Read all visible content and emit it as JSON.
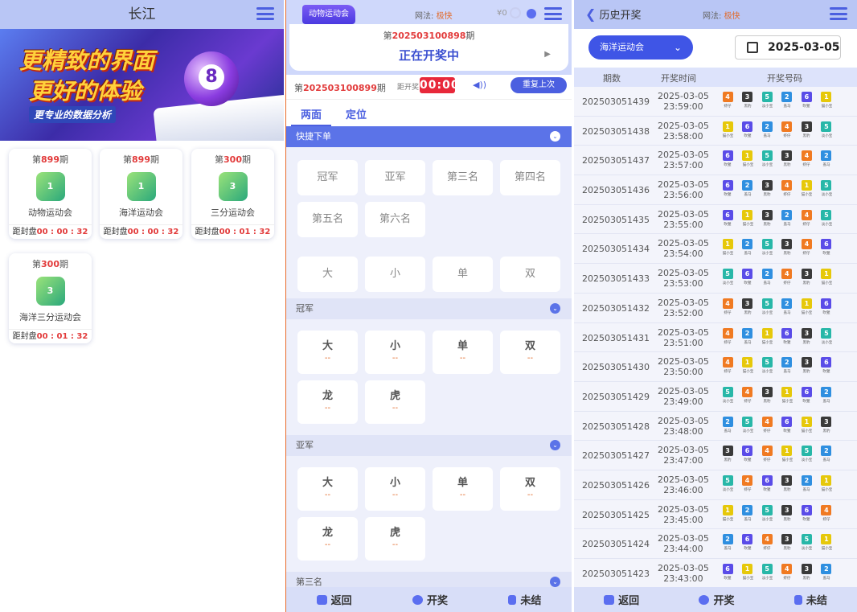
{
  "lobby": {
    "title": "长江",
    "banner": {
      "line1": "更精致的界面",
      "line2": "更好的体验",
      "line3": "更专业的数据分析",
      "ball": "8"
    },
    "games": [
      {
        "period_prefix": "第",
        "period": "899",
        "period_suffix": "期",
        "icon_text": "1",
        "name": "动物运动会",
        "countdown_label": "距封盘",
        "countdown": "00 : 00 : 32"
      },
      {
        "period_prefix": "第",
        "period": "899",
        "period_suffix": "期",
        "icon_text": "1",
        "name": "海洋运动会",
        "countdown_label": "距封盘",
        "countdown": "00 : 00 : 32"
      },
      {
        "period_prefix": "第",
        "period": "300",
        "period_suffix": "期",
        "icon_text": "3",
        "name": "三分运动会",
        "countdown_label": "距封盘",
        "countdown": "00 : 01 : 32"
      },
      {
        "period_prefix": "第",
        "period": "300",
        "period_suffix": "期",
        "icon_text": "3",
        "name": "海洋三分运动会",
        "countdown_label": "距封盘",
        "countdown": "00 : 01 : 32"
      }
    ]
  },
  "bet": {
    "game_tab": "动物运动会",
    "play_label": "网法:",
    "play_value": "极快",
    "balance": "¥0",
    "cur_prefix": "第",
    "cur_period": "202503100898",
    "cur_suffix": "期",
    "status": "正在开奖中",
    "next_prefix": "第",
    "next_period": "202503100899",
    "next_suffix": "期",
    "timer_label": "距开奖",
    "timer": "00:00",
    "repeat": "重复上次",
    "tabs": [
      "两面",
      "定位"
    ],
    "quick": {
      "title": "快捷下单",
      "positions": [
        "冠军",
        "亚军",
        "第三名",
        "第四名",
        "第五名",
        "第六名"
      ],
      "options": [
        "大",
        "小",
        "单",
        "双"
      ]
    },
    "sections": [
      {
        "title": "冠军",
        "items": [
          {
            "label": "大",
            "odds": "--"
          },
          {
            "label": "小",
            "odds": "--"
          },
          {
            "label": "单",
            "odds": "--"
          },
          {
            "label": "双",
            "odds": "--"
          },
          {
            "label": "龙",
            "odds": "--"
          },
          {
            "label": "虎",
            "odds": "--"
          }
        ]
      },
      {
        "title": "亚军",
        "items": [
          {
            "label": "大",
            "odds": "--"
          },
          {
            "label": "小",
            "odds": "--"
          },
          {
            "label": "单",
            "odds": "--"
          },
          {
            "label": "双",
            "odds": "--"
          },
          {
            "label": "龙",
            "odds": "--"
          },
          {
            "label": "虎",
            "odds": "--"
          }
        ]
      },
      {
        "title": "第三名",
        "items": []
      }
    ],
    "footer": [
      "返回",
      "开奖",
      "未结"
    ]
  },
  "history": {
    "back_label": "历史开奖",
    "play_label": "网法:",
    "play_value": "极快",
    "game_select": "海洋运动会",
    "date": "2025-03-05",
    "columns": [
      "期数",
      "开奖时间",
      "开奖号码"
    ],
    "colors": {
      "1": "#e6c80a",
      "2": "#2f8fe0",
      "3": "#3a3a3a",
      "4": "#f07a22",
      "5": "#28b7a8",
      "6": "#5a4ce8"
    },
    "zodiac": {
      "1": "猫小宝",
      "2": "盖马",
      "3": "黑豹",
      "4": "虾仔",
      "5": "淡小宝",
      "6": "吹猩"
    },
    "rows": [
      {
        "period": "202503051439",
        "date": "2025-03-05",
        "time": "23:59:00",
        "nums": [
          4,
          3,
          5,
          2,
          6,
          1
        ]
      },
      {
        "period": "202503051438",
        "date": "2025-03-05",
        "time": "23:58:00",
        "nums": [
          1,
          6,
          2,
          4,
          3,
          5
        ]
      },
      {
        "period": "202503051437",
        "date": "2025-03-05",
        "time": "23:57:00",
        "nums": [
          6,
          1,
          5,
          3,
          4,
          2
        ]
      },
      {
        "period": "202503051436",
        "date": "2025-03-05",
        "time": "23:56:00",
        "nums": [
          6,
          2,
          3,
          4,
          1,
          5
        ]
      },
      {
        "period": "202503051435",
        "date": "2025-03-05",
        "time": "23:55:00",
        "nums": [
          6,
          1,
          3,
          2,
          4,
          5
        ]
      },
      {
        "period": "202503051434",
        "date": "2025-03-05",
        "time": "23:54:00",
        "nums": [
          1,
          2,
          5,
          3,
          4,
          6
        ]
      },
      {
        "period": "202503051433",
        "date": "2025-03-05",
        "time": "23:53:00",
        "nums": [
          5,
          6,
          2,
          4,
          3,
          1
        ]
      },
      {
        "period": "202503051432",
        "date": "2025-03-05",
        "time": "23:52:00",
        "nums": [
          4,
          3,
          5,
          2,
          1,
          6
        ]
      },
      {
        "period": "202503051431",
        "date": "2025-03-05",
        "time": "23:51:00",
        "nums": [
          4,
          2,
          1,
          6,
          3,
          5
        ]
      },
      {
        "period": "202503051430",
        "date": "2025-03-05",
        "time": "23:50:00",
        "nums": [
          4,
          1,
          5,
          2,
          3,
          6
        ]
      },
      {
        "period": "202503051429",
        "date": "2025-03-05",
        "time": "23:49:00",
        "nums": [
          5,
          4,
          3,
          1,
          6,
          2
        ]
      },
      {
        "period": "202503051428",
        "date": "2025-03-05",
        "time": "23:48:00",
        "nums": [
          2,
          5,
          4,
          6,
          1,
          3
        ]
      },
      {
        "period": "202503051427",
        "date": "2025-03-05",
        "time": "23:47:00",
        "nums": [
          3,
          6,
          4,
          1,
          5,
          2
        ]
      },
      {
        "period": "202503051426",
        "date": "2025-03-05",
        "time": "23:46:00",
        "nums": [
          5,
          4,
          6,
          3,
          2,
          1
        ]
      },
      {
        "period": "202503051425",
        "date": "2025-03-05",
        "time": "23:45:00",
        "nums": [
          1,
          2,
          5,
          3,
          6,
          4
        ]
      },
      {
        "period": "202503051424",
        "date": "2025-03-05",
        "time": "23:44:00",
        "nums": [
          2,
          6,
          4,
          3,
          5,
          1
        ]
      },
      {
        "period": "202503051423",
        "date": "2025-03-05",
        "time": "23:43:00",
        "nums": [
          6,
          1,
          5,
          4,
          3,
          2
        ]
      }
    ],
    "footer": [
      "返回",
      "开奖",
      "未结"
    ]
  }
}
